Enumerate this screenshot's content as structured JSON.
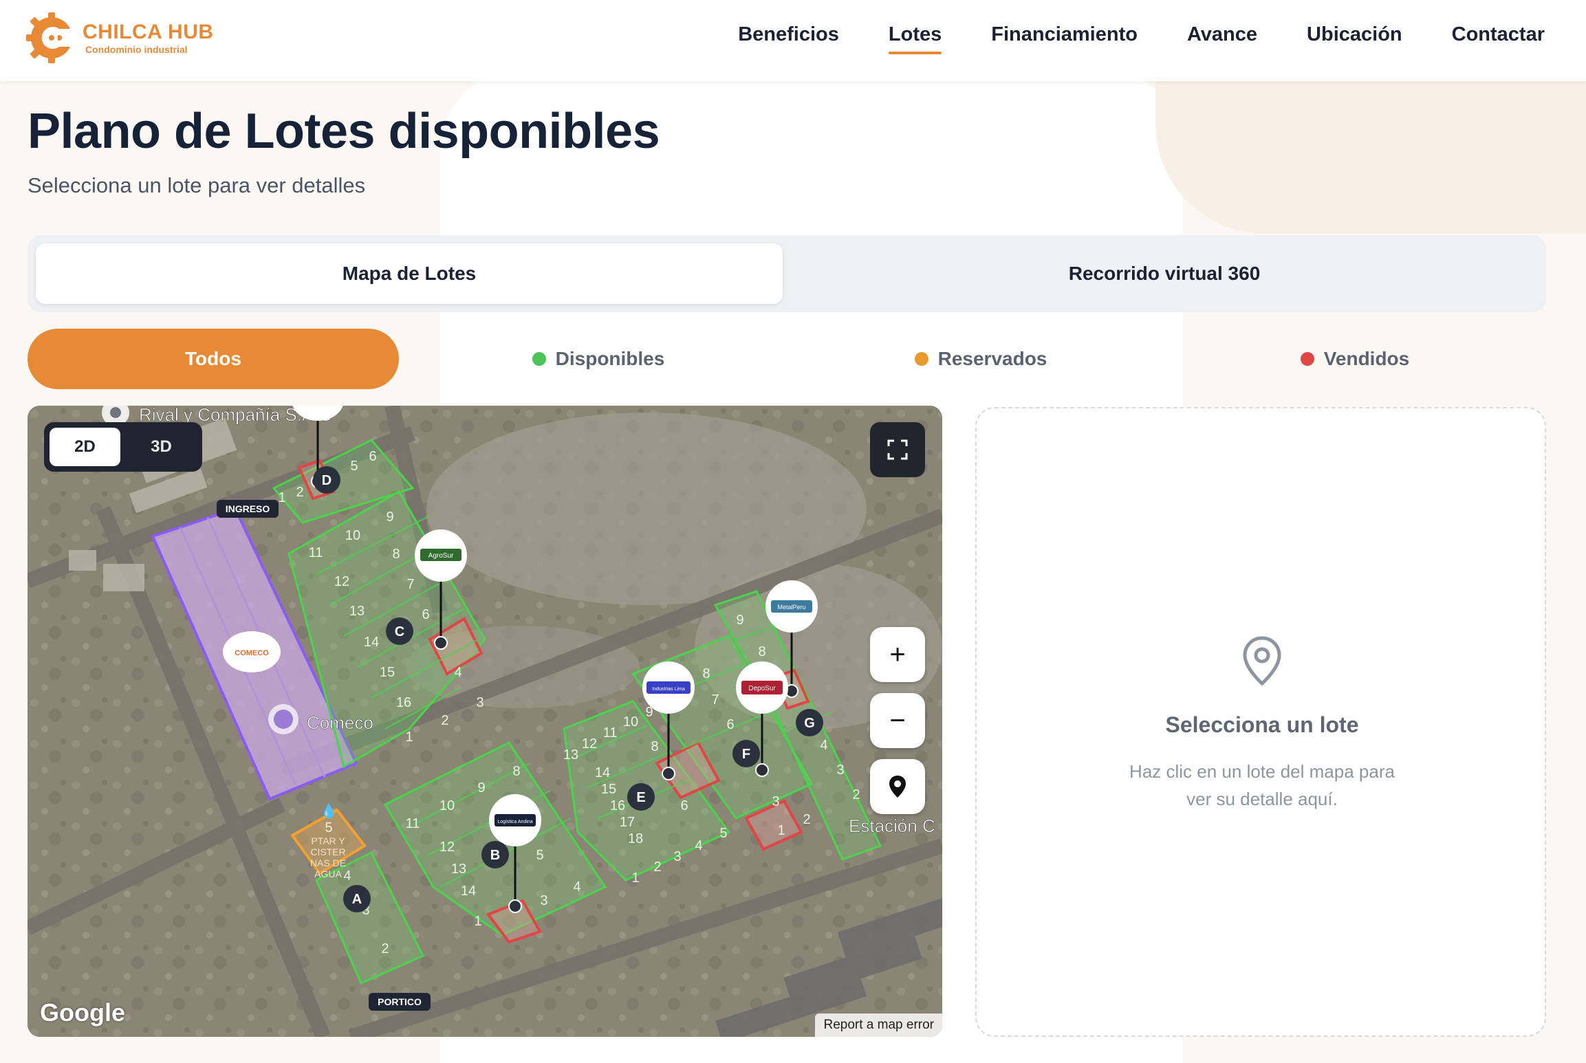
{
  "brand": {
    "name": "CHILCA HUB",
    "tagline": "Condominio industrial",
    "color": "#e88a35"
  },
  "nav": {
    "items": [
      {
        "label": "Beneficios"
      },
      {
        "label": "Lotes",
        "active": true
      },
      {
        "label": "Financiamiento"
      },
      {
        "label": "Avance"
      },
      {
        "label": "Ubicación"
      },
      {
        "label": "Contactar"
      }
    ]
  },
  "page": {
    "title": "Plano de Lotes disponibles",
    "subtitle": "Selecciona un lote para ver detalles"
  },
  "tabs": {
    "map": "Mapa de Lotes",
    "tour": "Recorrido virtual 360",
    "selected": "Mapa de Lotes"
  },
  "filters": {
    "selected": "Todos",
    "all": "Todos",
    "available": {
      "label": "Disponibles",
      "color": "#4cc257"
    },
    "reserved": {
      "label": "Reservados",
      "color": "#e89b2c"
    },
    "sold": {
      "label": "Vendidos",
      "color": "#e04646"
    }
  },
  "map": {
    "view_2d": "2D",
    "view_3d": "3D",
    "active_view": "2D",
    "fullscreen_icon": "fullscreen-icon",
    "zoom_in": "+",
    "zoom_out": "−",
    "locate_icon": "map-pin-icon",
    "attribution": "Google",
    "report": "Report a map error",
    "places": {
      "rival": "Rival y Compañía S.A.C",
      "comeco": "Comeco",
      "estacion": "Estación C"
    },
    "tags": {
      "ingreso": "INGRESO",
      "portico": "PORTICO"
    },
    "ptar": [
      "PTAR Y",
      "CISTER",
      "NAS DE",
      "AGUA"
    ],
    "blocks": [
      "A",
      "B",
      "C",
      "D",
      "E",
      "F",
      "G"
    ],
    "company_pins": {
      "comeco": "COMECO",
      "agrosur": "AgroSur",
      "metalperu": "MetalPeru",
      "industrias": "Industrias Lima",
      "deposur": "DepoSur",
      "logistica": "Logística Andina"
    },
    "lot_labels": {
      "d": [
        "1",
        "2",
        "5",
        "6"
      ],
      "c": [
        "1",
        "2",
        "3",
        "4",
        "6",
        "7",
        "8",
        "9",
        "10",
        "11",
        "12",
        "13",
        "14",
        "15",
        "16"
      ],
      "a": [
        "2",
        "3",
        "4",
        "5"
      ],
      "b": [
        "1",
        "3",
        "4",
        "5",
        "8",
        "9",
        "10",
        "11",
        "12",
        "13",
        "14"
      ],
      "e": [
        "1",
        "2",
        "3",
        "4",
        "5",
        "6",
        "8",
        "9",
        "10",
        "11",
        "12",
        "13",
        "14",
        "15",
        "16",
        "17",
        "18"
      ],
      "f": [
        "1",
        "2",
        "3",
        "6",
        "7",
        "8"
      ],
      "g": [
        "2",
        "3",
        "4",
        "8",
        "9"
      ]
    }
  },
  "detail": {
    "icon": "map-pin-icon",
    "title": "Selecciona un lote",
    "text": "Haz clic en un lote del mapa para ver su detalle aquí."
  }
}
